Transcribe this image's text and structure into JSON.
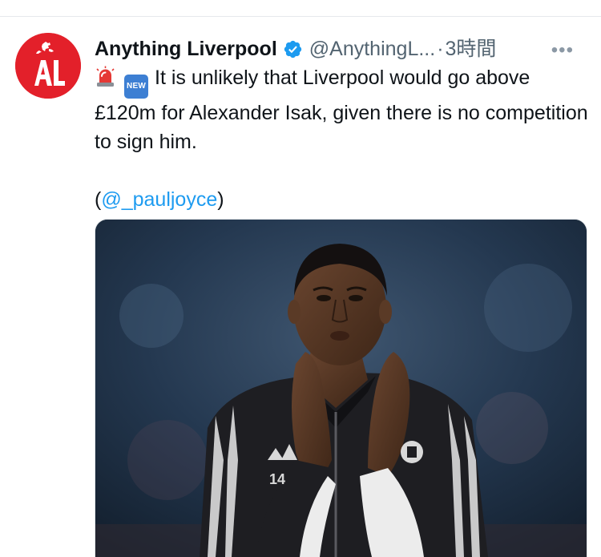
{
  "tweet": {
    "display_name": "Anything Liverpool",
    "handle": "@AnythingL...",
    "separator": "·",
    "time": "3時間",
    "more": "•••",
    "emoji_new_label": "NEW",
    "text": "It is unlikely that Liverpool would go above £120m for Alexander Isak, given there is no competition to sign him.",
    "mention_open": "(",
    "mention": "@_pauljoyce",
    "mention_close": ")",
    "avatar_letters": "AL",
    "jersey_number": "14"
  },
  "colors": {
    "avatar_bg": "#e3202a",
    "verified": "#1d9bf0",
    "link": "#1d9bf0",
    "secondary_text": "#536471"
  },
  "icons": {
    "verified": "verified-badge-icon",
    "alarm": "rotating-light-emoji",
    "new": "new-button-emoji",
    "more": "more-options-icon"
  }
}
